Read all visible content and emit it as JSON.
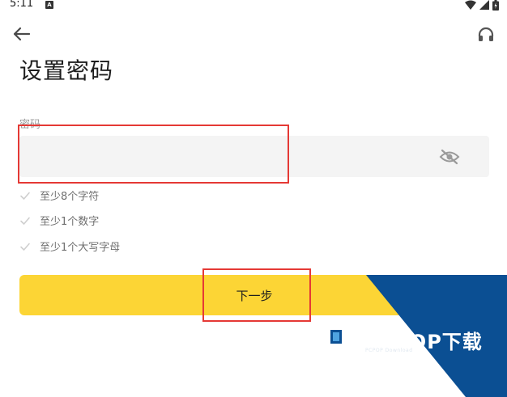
{
  "status_bar": {
    "time": "5:11",
    "notification_icon": "a-icon",
    "icons": [
      "wifi-icon",
      "signal-icon",
      "battery-icon"
    ]
  },
  "header": {
    "back_icon": "arrow-left-icon",
    "support_icon": "headset-icon"
  },
  "title": "设置密码",
  "password": {
    "label": "密码",
    "value": "",
    "placeholder": "",
    "visibility_icon": "eye-off-icon"
  },
  "rules": [
    {
      "icon": "check-icon",
      "text": "至少8个字符"
    },
    {
      "icon": "check-icon",
      "text": "至少1个数字"
    },
    {
      "icon": "check-icon",
      "text": "至少1个大写字母"
    }
  ],
  "next_button": {
    "label": "下一步"
  },
  "watermark": {
    "brand": "PCPOP下载",
    "sub": "PCPOP Download"
  },
  "colors": {
    "primary_button": "#fcd535",
    "field_background": "#f4f4f4",
    "annotation": "#e53935",
    "watermark_blue": "#0b4f93"
  }
}
